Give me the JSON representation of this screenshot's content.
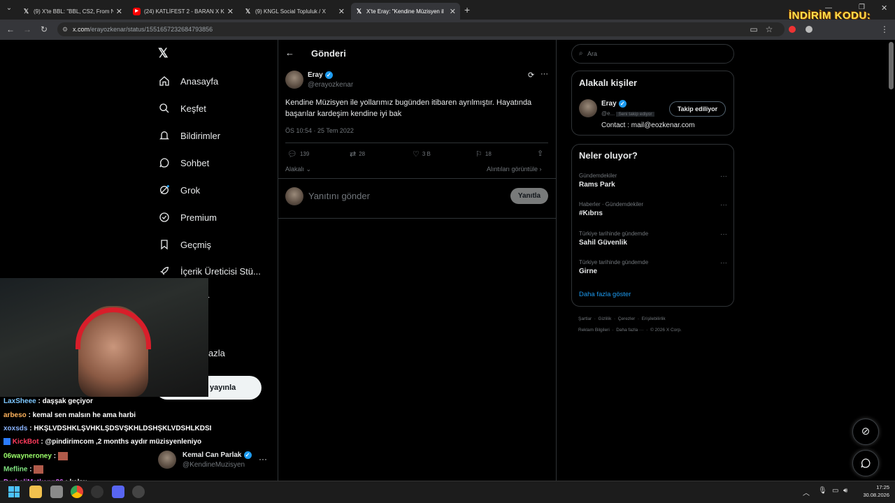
{
  "browser": {
    "tabs": [
      {
        "icon": "x-logo-icon",
        "title": "(9) X'te BBL: \"BBL, CS2, From N"
      },
      {
        "icon": "youtube-icon",
        "title": "(24) KATLİFEST 2 - BARAN X KA"
      },
      {
        "icon": "x-logo-icon",
        "title": "(9) KNGL Social Topluluk / X"
      },
      {
        "icon": "x-logo-icon",
        "title": "X'te Eray: \"Kendine Müzisyen il"
      }
    ],
    "url_host": "x.com",
    "url_path": "/erayozkenar/status/1551657232684793856",
    "overlay_text": "İNDİRİM KODU:"
  },
  "sidebar": {
    "items": [
      {
        "label": "Anasayfa",
        "icon": "home-icon"
      },
      {
        "label": "Keşfet",
        "icon": "search-icon"
      },
      {
        "label": "Bildirimler",
        "icon": "bell-icon"
      },
      {
        "label": "Sohbet",
        "icon": "chat-icon"
      },
      {
        "label": "Grok",
        "icon": "grok-icon"
      },
      {
        "label": "Premium",
        "icon": "verified-icon"
      },
      {
        "label": "Geçmiş",
        "icon": "bookmark-icon"
      },
      {
        "label": "İçerik Üreticisi Stü...",
        "icon": "rocket-icon"
      },
      {
        "label": "ler",
        "icon": ""
      },
      {
        "label": "azla",
        "icon": ""
      }
    ],
    "post_button": "yayınla",
    "account": {
      "name": "Kemal Can Parlak",
      "handle": "@KendineMuzisyen"
    }
  },
  "post": {
    "header": "Gönderi",
    "author": "Eray",
    "handle": "@erayozkenar",
    "text": "Kendine Müzisyen ile yollarımız bugünden itibaren ayrılmıştır. Hayatında başarılar kardeşim kendine iyi bak",
    "time": "ÖS 10:54 · 25 Tem 2022",
    "replies": "139",
    "reposts": "28",
    "likes": "3 B",
    "bookmarks": "18",
    "sort_label": "Alakalı",
    "quotes_label": "Alıntıları görüntüle",
    "reply_placeholder": "Yanıtını gönder",
    "reply_button": "Yanıtla"
  },
  "right": {
    "search_placeholder": "Ara",
    "related_title": "Alakalı kişiler",
    "related": {
      "name": "Eray",
      "handle": "@e...",
      "follows_you": "Seni takip ediyor",
      "button": "Takip ediliyor",
      "bio": "Contact : mail@eozkenar.com"
    },
    "trends_title": "Neler oluyor?",
    "trends": [
      {
        "category": "Gündemdekiler",
        "name": "Rams Park"
      },
      {
        "category": "Haberler · Gündemdekiler",
        "name": "#Kıbrıs"
      },
      {
        "category": "Türkiye tarihinde gündemde",
        "name": "Sahil Güvenlik"
      },
      {
        "category": "Türkiye tarihinde gündemde",
        "name": "Girne"
      }
    ],
    "show_more": "Daha fazla göster",
    "footer_line1": [
      "Şartlar",
      "Gizlilik",
      "Çerezler",
      "Erişilebilirlik"
    ],
    "footer_line2": [
      "Reklam Bilgileri",
      "Daha fazla ···",
      "© 2026 X Corp."
    ]
  },
  "chat": [
    {
      "user": "LaxSheee",
      "color": "#7ec8ff",
      "msg": ": daşşak geçiyor"
    },
    {
      "user": "arbeso",
      "color": "#ffb35c",
      "msg": ": kemal sen malsın he ama harbi"
    },
    {
      "user": "xoxsds",
      "color": "#8ab4ff",
      "msg": ": HKŞLVDSHKLŞVHKLŞDSVŞKHLDSHŞKLVDSHLKDSI"
    },
    {
      "user": "KickBot",
      "color": "#ff3b5c",
      "msg": ": @pindirimcom ,2 months aydır müzisyenleniyo"
    },
    {
      "user": "06wayneroney",
      "color": "#9bff6a",
      "msg": ":"
    },
    {
      "user": "Mefline",
      "color": "#7ee07e",
      "msg": ":"
    },
    {
      "user": "DarbeliMatkapp26",
      "color": "#e06eff",
      "msg": ": kekw"
    }
  ],
  "taskbar": {
    "time": "17:25",
    "date": "30.08.2026"
  }
}
